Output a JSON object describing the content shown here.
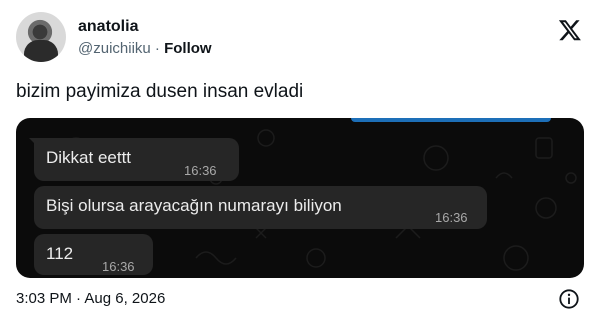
{
  "tweet": {
    "author": {
      "display_name": "anatolia",
      "handle": "@zuichiiku",
      "separator": " · ",
      "follow_label": "Follow"
    },
    "text": "bizim payimiza dusen insan evladi",
    "footer": {
      "time": "3:03 PM",
      "date": "Aug 6, 2026",
      "separator": " · "
    }
  },
  "chat_screenshot": {
    "messages": [
      {
        "text": "Dikkat eettt",
        "time": "16:36"
      },
      {
        "text": "Bişi olursa arayacağın numarayı biliyon",
        "time": "16:36"
      },
      {
        "text": "112",
        "time": "16:36"
      }
    ]
  },
  "icons": {
    "brand": "x-logo-icon",
    "info": "info-icon"
  },
  "colors": {
    "text_primary": "#0f1419",
    "text_secondary": "#536471",
    "chat_background": "#0b0b0b",
    "bubble_background": "#262626"
  }
}
